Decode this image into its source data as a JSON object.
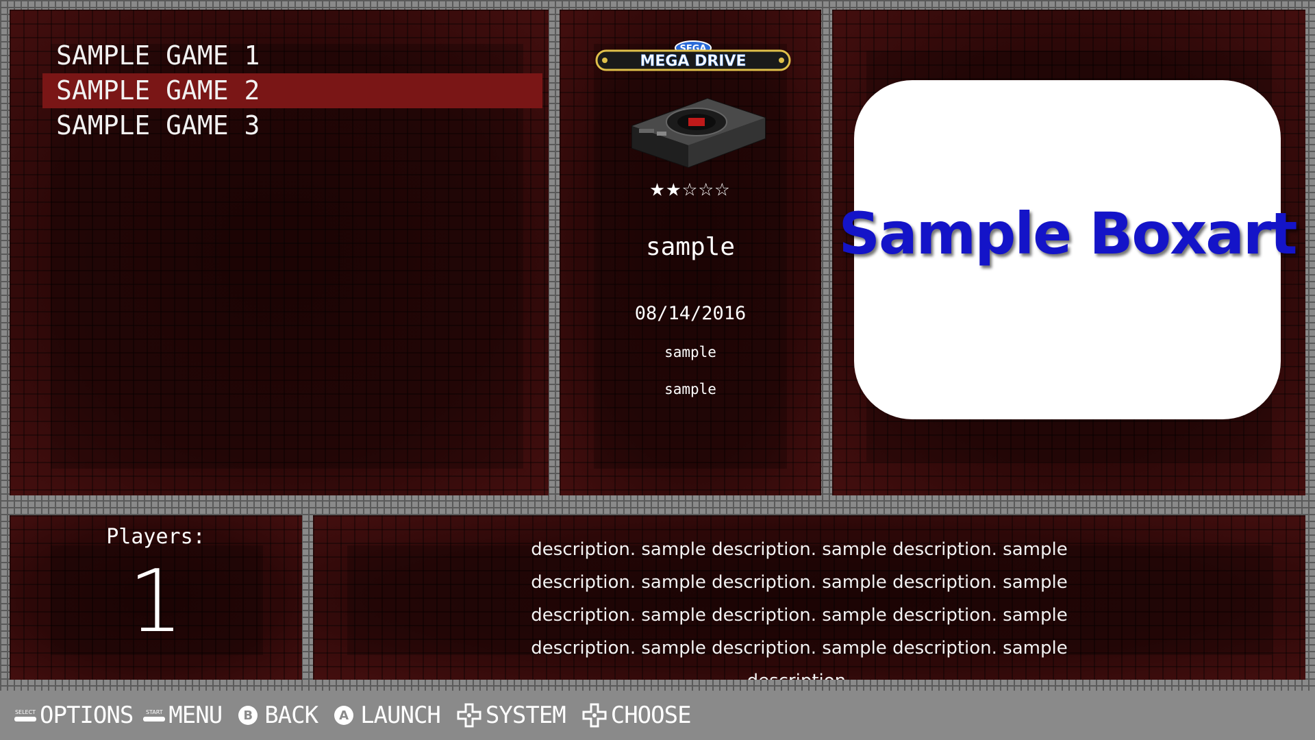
{
  "game_list": {
    "items": [
      {
        "label": "SAMPLE GAME 1",
        "selected": false
      },
      {
        "label": "SAMPLE GAME 2",
        "selected": true
      },
      {
        "label": "SAMPLE GAME 3",
        "selected": false
      }
    ]
  },
  "system": {
    "logo_top": "SEGA",
    "logo_bottom": "MEGA DRIVE"
  },
  "metadata": {
    "rating_stars": 2,
    "rating_max": 5,
    "developer": "sample",
    "release_date": "08/14/2016",
    "publisher": "sample",
    "genre": "sample"
  },
  "boxart": {
    "label": "Sample Boxart"
  },
  "players": {
    "label": "Players:",
    "value": "1"
  },
  "description": {
    "text": "description. sample description. sample description. sample description. sample description. sample description. sample description. sample description. sample description. sample description. sample description. sample description. sample description."
  },
  "help_bar": {
    "items": [
      {
        "icon": "select-key-icon",
        "cap": "SELECT",
        "label": "OPTIONS"
      },
      {
        "icon": "start-key-icon",
        "cap": "START",
        "label": "MENU"
      },
      {
        "icon": "b-button-icon",
        "cap": "B",
        "label": "BACK"
      },
      {
        "icon": "a-button-icon",
        "cap": "A",
        "label": "LAUNCH"
      },
      {
        "icon": "dpad-icon",
        "cap": "",
        "label": "SYSTEM"
      },
      {
        "icon": "dpad-icon",
        "cap": "",
        "label": "CHOOSE"
      }
    ]
  },
  "colors": {
    "panel_bg": "#3a0b0b",
    "selection": "#7a1616",
    "frame": "#8a8a8a",
    "boxart_text": "#1414c8"
  }
}
